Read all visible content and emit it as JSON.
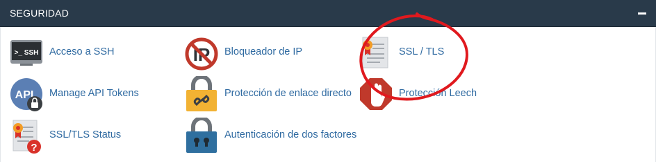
{
  "section": {
    "title": "SEGURIDAD",
    "collapse_icon": "minus-icon"
  },
  "items": [
    {
      "label": "Acceso a SSH",
      "icon": "terminal-ssh-icon",
      "icon_text": ">_ SSH"
    },
    {
      "label": "Bloqueador de IP",
      "icon": "ip-blocker-icon",
      "icon_text": "IP"
    },
    {
      "label": "SSL / TLS",
      "icon": "certificate-icon"
    },
    {
      "label": "Manage API Tokens",
      "icon": "api-token-icon",
      "icon_text": "API"
    },
    {
      "label": "Protección de enlace directo",
      "icon": "padlock-link-icon"
    },
    {
      "label": "Protección Leech",
      "icon": "hand-stop-icon"
    },
    {
      "label": "SSL/TLS Status",
      "icon": "certificate-warning-icon",
      "icon_text": "?"
    },
    {
      "label": "Autenticación de dos factores",
      "icon": "padlock-2fa-icon"
    }
  ],
  "colors": {
    "header_bg": "#293a4a",
    "link": "#2f6aa1",
    "annotation_circle": "#e0191e"
  }
}
